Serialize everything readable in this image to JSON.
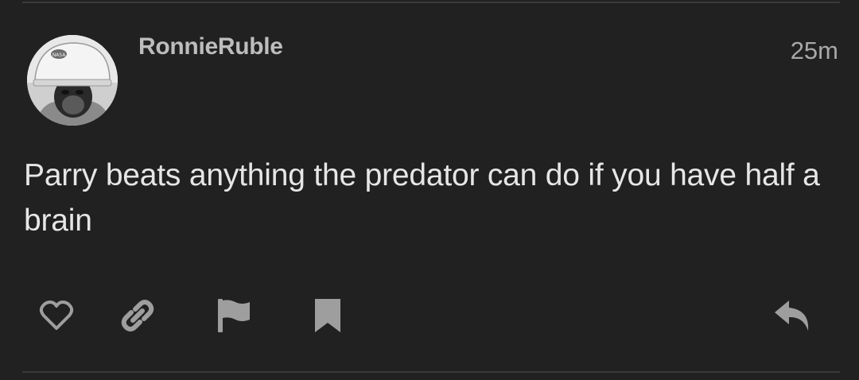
{
  "post": {
    "author": "RonnieRuble",
    "time": "25m",
    "text": "Parry beats anything the predator can do if you have half a brain",
    "avatar_icon": "nasa-helmet-chimp-avatar",
    "avatar_helmet_text": "NASA"
  },
  "actions": {
    "like_icon": "heart-outline-icon",
    "link_icon": "link-icon",
    "flag_icon": "flag-icon",
    "bookmark_icon": "bookmark-icon",
    "reply_icon": "reply-icon"
  },
  "colors": {
    "background": "#212121",
    "username": "#bdbdbd",
    "text": "#e6e6e6",
    "icon": "#9e9e9e",
    "divider": "#3a3a3a"
  }
}
